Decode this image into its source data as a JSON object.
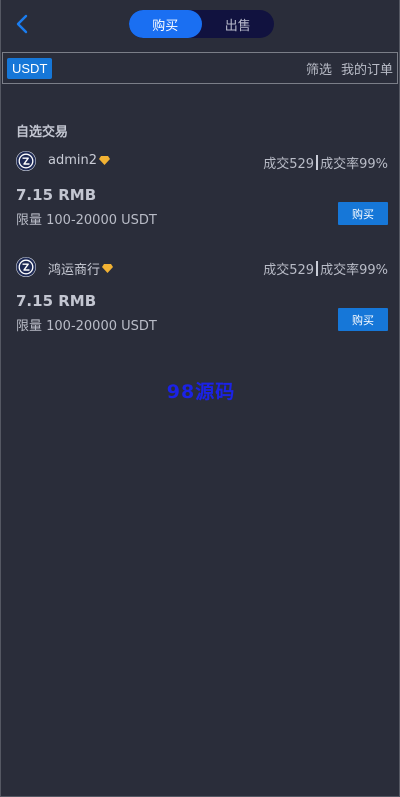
{
  "header": {
    "tabs": [
      {
        "label": "购买",
        "active": true
      },
      {
        "label": "出售",
        "active": false
      }
    ]
  },
  "toolbar": {
    "coin": "USDT",
    "filter_label": "筛选",
    "orders_label": "我的订单"
  },
  "section": {
    "title": "自选交易"
  },
  "trades": [
    {
      "name": "admin2",
      "deals": "成交529",
      "rate": "成交率99%",
      "price": "7.15 RMB",
      "limit": "限量 100-20000 USDT",
      "buy_label": "购买"
    },
    {
      "name": "鸿运商行",
      "deals": "成交529",
      "rate": "成交率99%",
      "price": "7.15 RMB",
      "limit": "限量 100-20000 USDT",
      "buy_label": "购买"
    }
  ],
  "watermark": "98源码",
  "colors": {
    "background": "#2a2d3a",
    "accent": "#1677d8",
    "tab_active": "#1a6ff2",
    "tab_inactive": "#11123f",
    "watermark": "#1b22e6",
    "diamond": "#f2b233"
  }
}
